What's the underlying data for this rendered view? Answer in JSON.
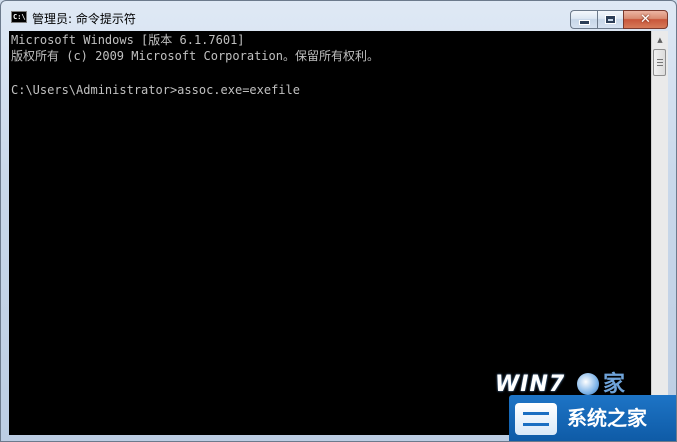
{
  "window": {
    "title": "管理员: 命令提示符",
    "app_icon_text": "C:\\"
  },
  "caption_buttons": {
    "minimize": "minimize",
    "maximize": "maximize",
    "close": "close",
    "close_glyph": "✕"
  },
  "console": {
    "lines": [
      "Microsoft Windows [版本 6.1.7601]",
      "版权所有 (c) 2009 Microsoft Corporation。保留所有权利。",
      "C:\\Users\\Administrator>assoc.exe=exefile"
    ],
    "background": "#000000",
    "foreground": "#c0c0c0"
  },
  "scrollbar": {
    "up_arrow": "▲"
  },
  "watermark": {
    "logo": "WIN7",
    "logo_suffix": "家",
    "text": "系统之家"
  }
}
